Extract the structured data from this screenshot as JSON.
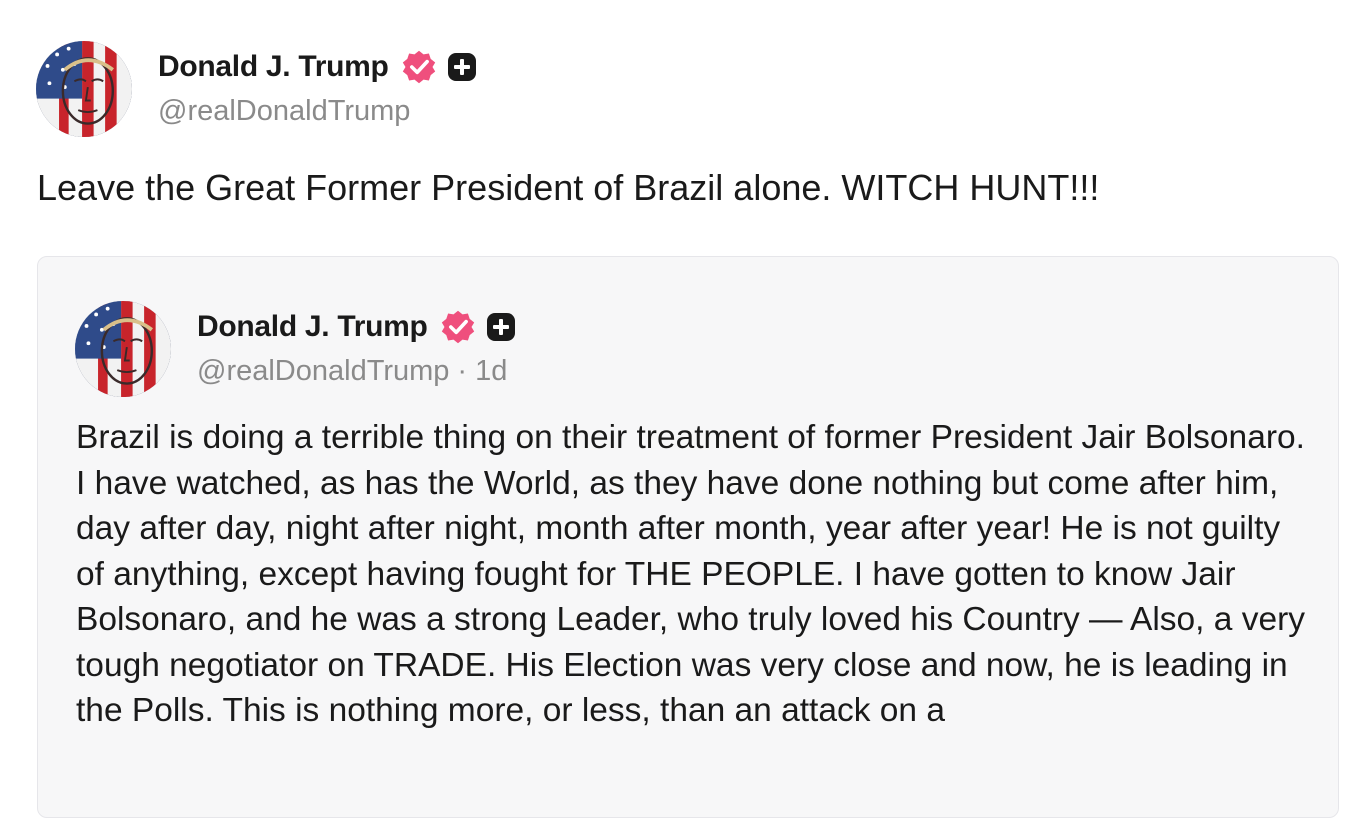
{
  "post": {
    "author": {
      "display_name": "Donald J. Trump",
      "handle": "@realDonaldTrump",
      "verified_icon": "verified-badge-icon",
      "badge_icon": "plus-square-icon"
    },
    "text": "Leave the Great Former President of Brazil alone. WITCH HUNT!!!"
  },
  "quoted_post": {
    "author": {
      "display_name": "Donald J. Trump",
      "handle": "@realDonaldTrump",
      "separator": "·",
      "timestamp": "1d",
      "verified_icon": "verified-badge-icon",
      "badge_icon": "plus-square-icon"
    },
    "text": "Brazil is doing a terrible thing on their treatment of former President Jair Bolsonaro. I have watched, as has the World, as they have done nothing but come after him, day after day, night after night, month after month, year after year! He is not guilty of anything, except having fought for THE PEOPLE. I have gotten to know Jair Bolsonaro, and he was a strong Leader, who truly loved his Country — Also, a very tough negotiator on TRADE. His Election was very close and now, he is leading in the Polls. This is nothing more, or less, than an attack on a"
  },
  "colors": {
    "verified_badge": "#ef4f7d",
    "text": "#1a1a1a",
    "muted": "#8a8a8a",
    "card_bg": "#f7f7f8"
  }
}
